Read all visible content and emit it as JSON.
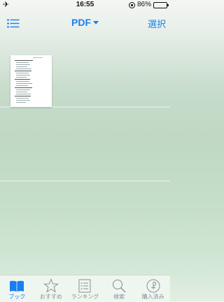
{
  "status_bar": {
    "time": "16:55",
    "battery_text": "86%",
    "battery_level": 0.86,
    "icons": [
      "airplane-icon",
      "rotation-lock-icon",
      "battery-icon"
    ]
  },
  "nav": {
    "title": "PDF",
    "select_label": "選択",
    "accent_color": "#1a7ef2"
  },
  "tabs": [
    {
      "label": "ブック",
      "icon": "book-icon",
      "active": true
    },
    {
      "label": "おすすめ",
      "icon": "star-icon",
      "active": false
    },
    {
      "label": "ランキング",
      "icon": "list-icon",
      "active": false
    },
    {
      "label": "検索",
      "icon": "search-icon",
      "active": false
    },
    {
      "label": "購入済み",
      "icon": "purchased-icon",
      "active": false
    }
  ]
}
